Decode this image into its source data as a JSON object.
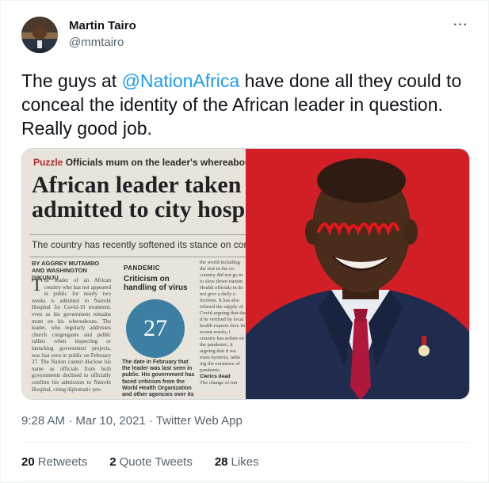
{
  "author": {
    "name": "Martin Tairo",
    "handle": "@mmtairo"
  },
  "tweet": {
    "text_before": "The guys at ",
    "mention": "@NationAfrica",
    "text_after": " have done all they could to conceal the identity of the African leader in question. Really good job."
  },
  "clipping": {
    "puzzle": "Puzzle",
    "kicker": "Officials mum on the leader's whereabout",
    "headline_line1": "African leader taken i",
    "headline_line2": "admitted to city hospi",
    "standfirst": "The country has recently softened its stance on coronavir",
    "byline": "BY AGGREY MUTAMBO AND WASHINGTON GIKUNJU",
    "col1_dropcap": "T",
    "col1_text": "he leader of an African country who has not appeared in public for nearly two weeks is admitted to Nairobi Hospital for Covid-19 treatment, even as his government remains mum on his whereabouts. The leader, who regularly addresses church congregants and public rallies when inspecting or launching government projects, was last seen in public on February 27. The Nation cannot disclose his name as officials from both governments declined to officially confirm his admission to Nairobi Hospital, citing diplomatic pro-",
    "pandemic_label": "PANDEMIC",
    "pandemic_sub": "Criticism on handling of virus",
    "big_number": "27",
    "col2_text": "The date in February that the leader was last seen in public. His government has faced criticism from the World Health Organization and other agencies over its",
    "col3_text": "the world including the rest in the co country did not go in to slow down transm Health officials in do not give a daily u fections. It has also refused the supply of Covid arguing that the d be verified by local health experts first. In recent weeks, t country has soften on the pandemic, it arguing that it wa mass hysteria, rathe ing the existence of pandemic.",
    "col3_clerics": "Clerics dead",
    "col3_tail": "The change of ton"
  },
  "meta": {
    "time": "9:28 AM",
    "separator": " · ",
    "date": "Mar 10, 2021",
    "app": "Twitter Web App"
  },
  "stats": {
    "retweets_count": "20",
    "retweets_label": "Retweets",
    "quotes_count": "2",
    "quotes_label": "Quote Tweets",
    "likes_count": "28",
    "likes_label": "Likes"
  },
  "icons": {
    "more": "more-options-icon"
  },
  "colors": {
    "accent": "#1d9bf0",
    "text": "#0f1419",
    "secondary": "#536471",
    "photo_bg": "#d21f26",
    "scribble": "#e8161c",
    "figure_blue": "#3d7fa2"
  }
}
